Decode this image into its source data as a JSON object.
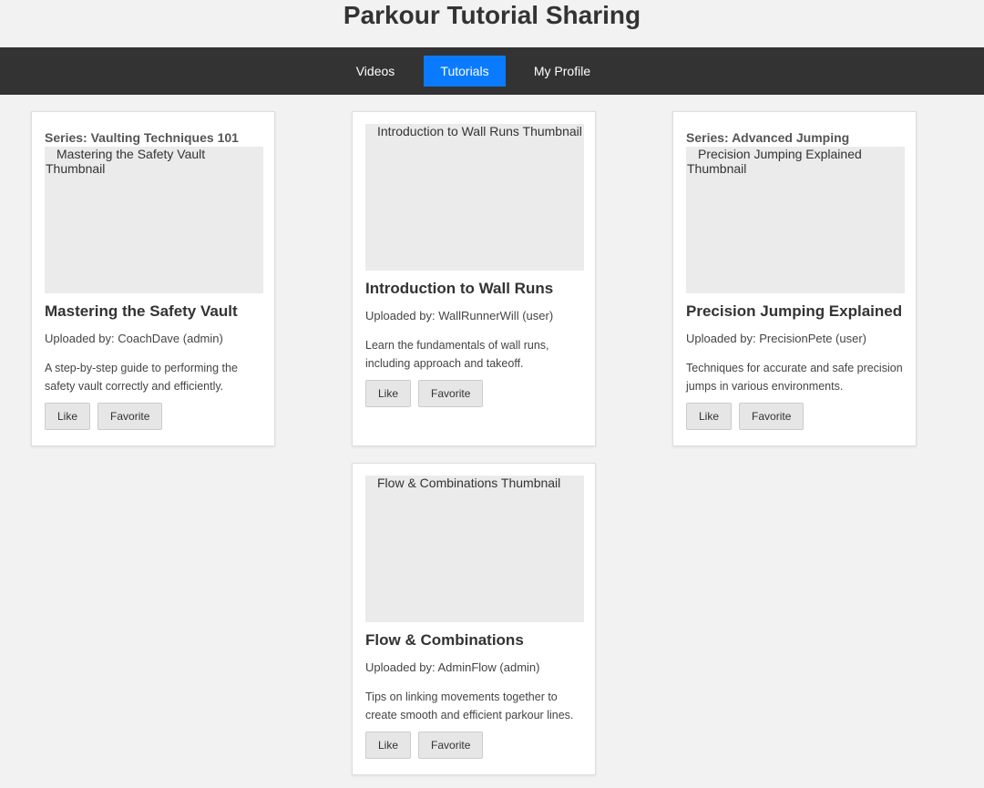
{
  "header": {
    "title": "Parkour Tutorial Sharing"
  },
  "nav": {
    "items": [
      {
        "label": "Videos",
        "active": false
      },
      {
        "label": "Tutorials",
        "active": true
      },
      {
        "label": "My Profile",
        "active": false
      }
    ],
    "active_color": "#0a7bff",
    "bar_color": "#333333"
  },
  "cards": [
    {
      "series": "Series: Vaulting Techniques 101",
      "thumb_alt": "Mastering the Safety Vault Thumbnail",
      "title": "Mastering the Safety Vault",
      "uploader": "Uploaded by: CoachDave (admin)",
      "description": "A step-by-step guide to performing the safety vault correctly and efficiently.",
      "like_label": "Like",
      "favorite_label": "Favorite"
    },
    {
      "series": "",
      "thumb_alt": "Introduction to Wall Runs Thumbnail",
      "title": "Introduction to Wall Runs",
      "uploader": "Uploaded by: WallRunnerWill (user)",
      "description": "Learn the fundamentals of wall runs, including approach and takeoff.",
      "like_label": "Like",
      "favorite_label": "Favorite"
    },
    {
      "series": "Series: Advanced Jumping",
      "thumb_alt": "Precision Jumping Explained Thumbnail",
      "title": "Precision Jumping Explained",
      "uploader": "Uploaded by: PrecisionPete (user)",
      "description": "Techniques for accurate and safe precision jumps in various environments.",
      "like_label": "Like",
      "favorite_label": "Favorite"
    },
    {
      "series": "",
      "thumb_alt": "Flow & Combinations Thumbnail",
      "title": "Flow & Combinations",
      "uploader": "Uploaded by: AdminFlow (admin)",
      "description": "Tips on linking movements together to create smooth and efficient parkour lines.",
      "like_label": "Like",
      "favorite_label": "Favorite"
    }
  ]
}
